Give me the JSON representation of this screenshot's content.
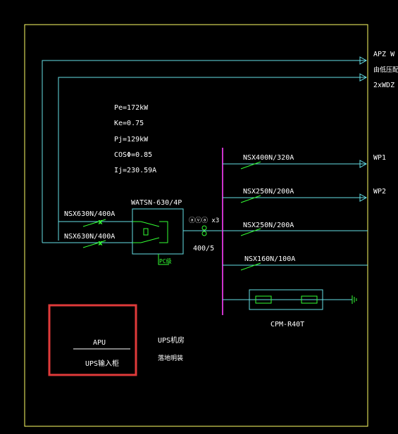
{
  "colors": {
    "background": "#000000",
    "frame": "#ffff66",
    "line": "#66e0e6",
    "busbar": "#cc33cc",
    "breaker": "#33ff33",
    "highlight": "#e03a3a",
    "text": "#ffffff"
  },
  "feeders_out": [
    {
      "label": "APZ W"
    },
    {
      "label": "由低压配电"
    },
    {
      "label": "2xWDZ"
    }
  ],
  "load_calc": [
    {
      "text": "Pe=172kW"
    },
    {
      "text": "Ke=0.75"
    },
    {
      "text": "Pj=129kW"
    },
    {
      "text": "COSΦ=0.85"
    },
    {
      "text": "Ij=230.59A"
    }
  ],
  "incomers": [
    {
      "label": "NSX630N/400A"
    },
    {
      "label": "NSX630N/400A"
    }
  ],
  "ats": {
    "label": "WATSN-630/4P",
    "controller": "PC级"
  },
  "ct": {
    "symbol": "ⓐⓥⓐ x3",
    "ratio": "400/5"
  },
  "branches": [
    {
      "breaker": "NSX400N/320A",
      "circuit": "WP1"
    },
    {
      "breaker": "NSX250N/200A",
      "circuit": "WP2"
    },
    {
      "breaker": "NSX250N/200A",
      "circuit": ""
    },
    {
      "breaker": "NSX160N/100A",
      "circuit": ""
    }
  ],
  "spd": {
    "label": "CPM-R40T"
  },
  "panel": {
    "name": "APU",
    "description": "UPS输入柜",
    "room": "UPS机房",
    "mount": "落地明装"
  }
}
